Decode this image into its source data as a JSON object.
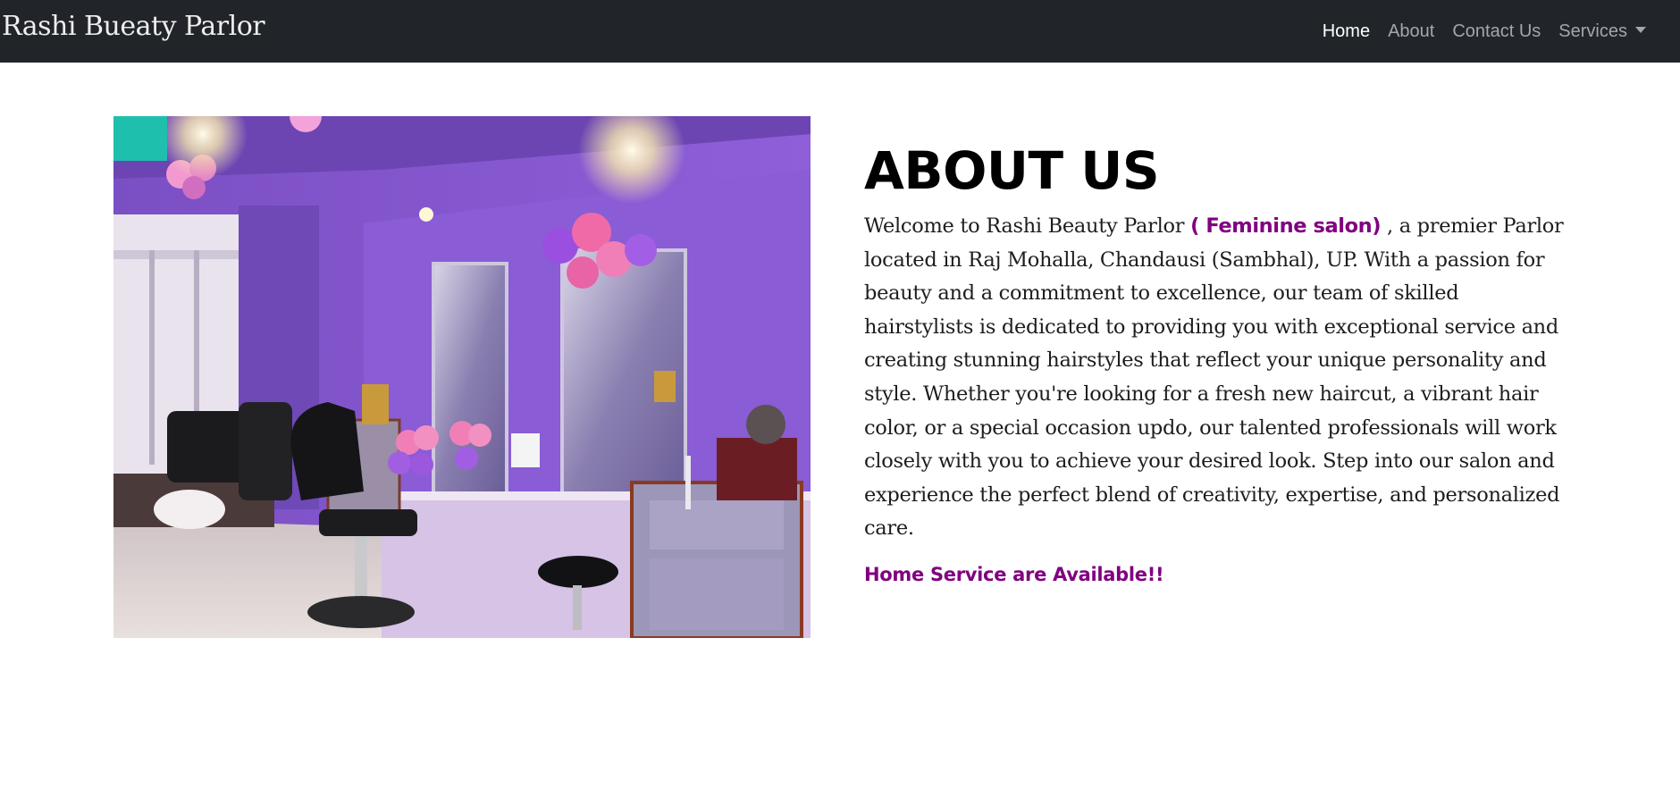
{
  "navbar": {
    "brand": "Rashi Bueaty Parlor",
    "links": [
      {
        "label": "Home",
        "active": true
      },
      {
        "label": "About",
        "active": false
      },
      {
        "label": "Contact Us",
        "active": false
      },
      {
        "label": "Services",
        "active": false,
        "dropdown": true
      }
    ]
  },
  "hero_image": {
    "alt": "Salon interior with purple walls, mirrors, styling chairs and pink balloons"
  },
  "about": {
    "title": "ABOUT US",
    "intro_before": "Welcome to Rashi Beauty Parlor ",
    "highlight": "( Feminine salon)",
    "intro_after": " , a premier Parlor located in Raj Mohalla, Chandausi (Sambhal), UP. With a passion for beauty and a commitment to excellence, our team of skilled hairstylists is dedicated to providing you with exceptional service and creating stunning hairstyles that reflect your unique personality and style. Whether you're looking for a fresh new haircut, a vibrant hair color, or a special occasion updo, our talented professionals will work closely with you to achieve your desired look. Step into our salon and experience the perfect blend of creativity, expertise, and personalized care.",
    "home_service": "Home Service are Available!!"
  },
  "colors": {
    "navbar_bg": "#212529",
    "accent_purple": "#800080"
  }
}
